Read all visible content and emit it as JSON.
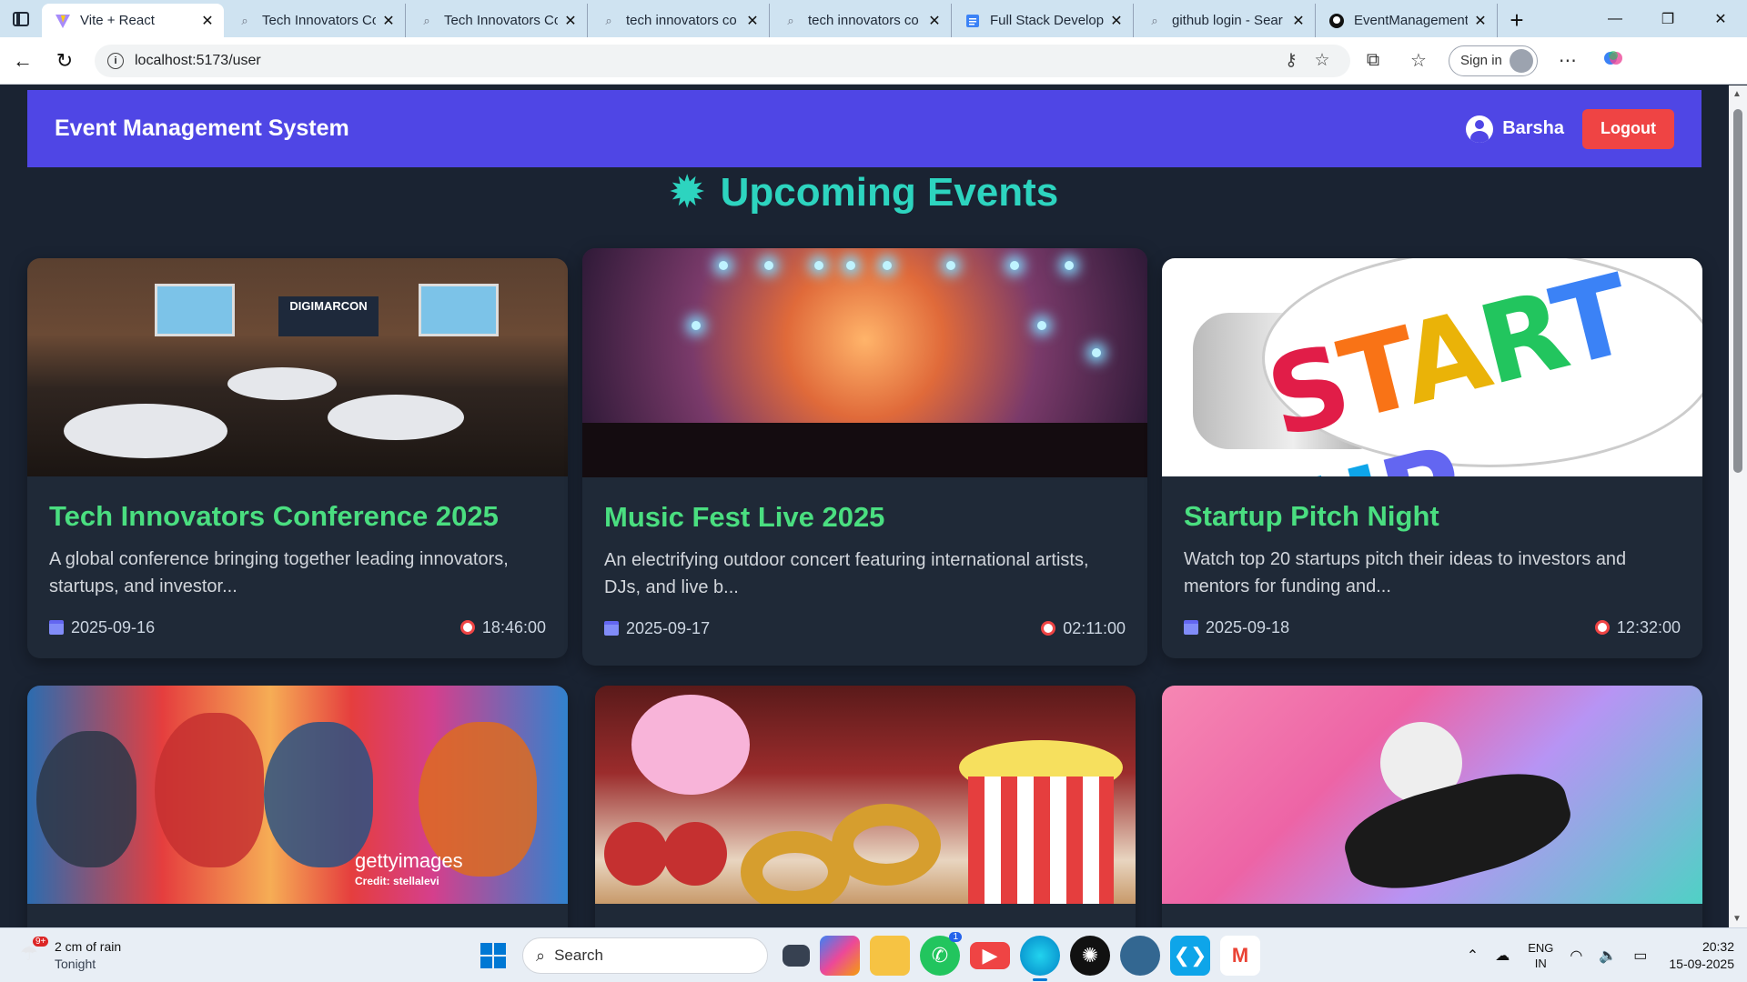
{
  "browser": {
    "tabs": [
      {
        "title": "Vite + React",
        "favicon": "vite-icon",
        "active": true
      },
      {
        "title": "Tech Innovators Co",
        "favicon": "search-icon",
        "active": false
      },
      {
        "title": "Tech Innovators Co",
        "favicon": "search-icon",
        "active": false
      },
      {
        "title": "tech innovators co",
        "favicon": "search-icon",
        "active": false
      },
      {
        "title": "tech innovators co",
        "favicon": "search-icon",
        "active": false
      },
      {
        "title": "Full Stack Develop",
        "favicon": "doc-icon",
        "active": false
      },
      {
        "title": "github login - Sear",
        "favicon": "search-icon",
        "active": false
      },
      {
        "title": "EventManagement",
        "favicon": "github-icon",
        "active": false
      }
    ],
    "url": "localhost:5173/user",
    "sign_in_label": "Sign in"
  },
  "app": {
    "brand": "Event Management System",
    "user_name": "Barsha",
    "logout_label": "Logout",
    "heading": "Upcoming Events",
    "accent": "#4f46e5",
    "title_color": "#4ade80",
    "heading_color": "#2dd4bf"
  },
  "events": [
    {
      "title": "Tech Innovators Conference 2025",
      "description": "A global conference bringing together leading innovators, startups, and investor...",
      "date": "2025-09-16",
      "time": "18:46:00",
      "image_text": "DIGIMARCON"
    },
    {
      "title": "Music Fest Live 2025",
      "description": "An electrifying outdoor concert featuring international artists, DJs, and live b...",
      "date": "2025-09-17",
      "time": "02:11:00"
    },
    {
      "title": "Startup Pitch Night",
      "description": "Watch top 20 startups pitch their ideas to investors and mentors for funding and...",
      "date": "2025-09-18",
      "time": "12:32:00",
      "image_text": "START UP"
    },
    {
      "image_text": "gettyimages",
      "image_credit": "Credit: stellalevi"
    },
    {},
    {}
  ],
  "taskbar": {
    "weather_main": "2 cm of rain",
    "weather_sub": "Tonight",
    "weather_badge": "9+",
    "search_label": "Search",
    "whatsapp_badge": "1",
    "lang_1": "ENG",
    "lang_2": "IN",
    "time": "20:32",
    "date": "15-09-2025"
  }
}
